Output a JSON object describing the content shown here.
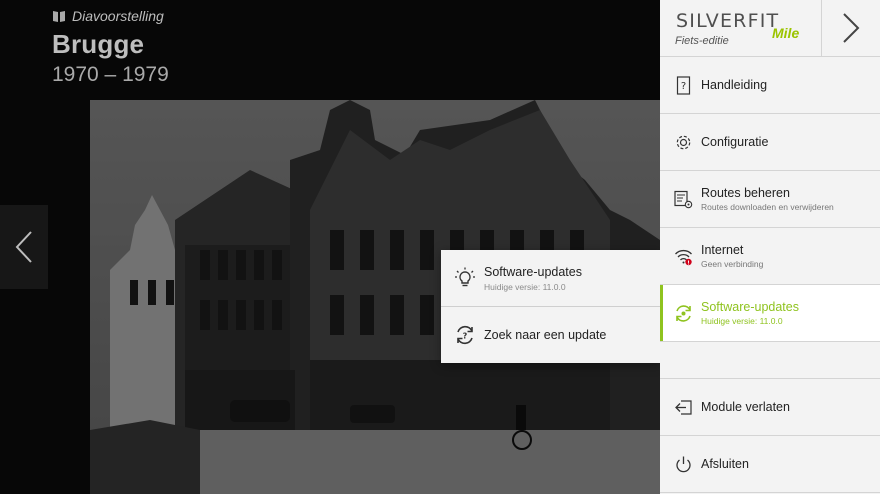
{
  "slideshow": {
    "kicker": "Diavoorstelling",
    "title": "Brugge",
    "years": "1970 – 1979"
  },
  "logo": {
    "word": "SILVERFIT",
    "edition": "Fiets-editie",
    "mile": "Mile"
  },
  "menu": {
    "items": [
      {
        "label": "Handleiding",
        "sub": "",
        "icon": "help-page-icon"
      },
      {
        "label": "Configuratie",
        "sub": "",
        "icon": "gear-icon"
      },
      {
        "label": "Routes beheren",
        "sub": "Routes downloaden en verwijderen",
        "icon": "routes-settings-icon"
      },
      {
        "label": "Internet",
        "sub": "Geen verbinding",
        "icon": "wifi-error-icon"
      },
      {
        "label": "Software-updates",
        "sub": "Huidige versie: 11.0.0",
        "icon": "sync-icon"
      },
      {
        "label": "Module verlaten",
        "sub": "",
        "icon": "exit-icon"
      },
      {
        "label": "Afsluiten",
        "sub": "",
        "icon": "power-icon"
      }
    ]
  },
  "flyout": {
    "header_label": "Software-updates",
    "header_sub": "Huidige versie: 11.0.0",
    "action_label": "Zoek naar een update"
  },
  "colors": {
    "accent": "#8fc31f",
    "menu_bg": "#f3f3f3",
    "badge": "#d0021b"
  }
}
